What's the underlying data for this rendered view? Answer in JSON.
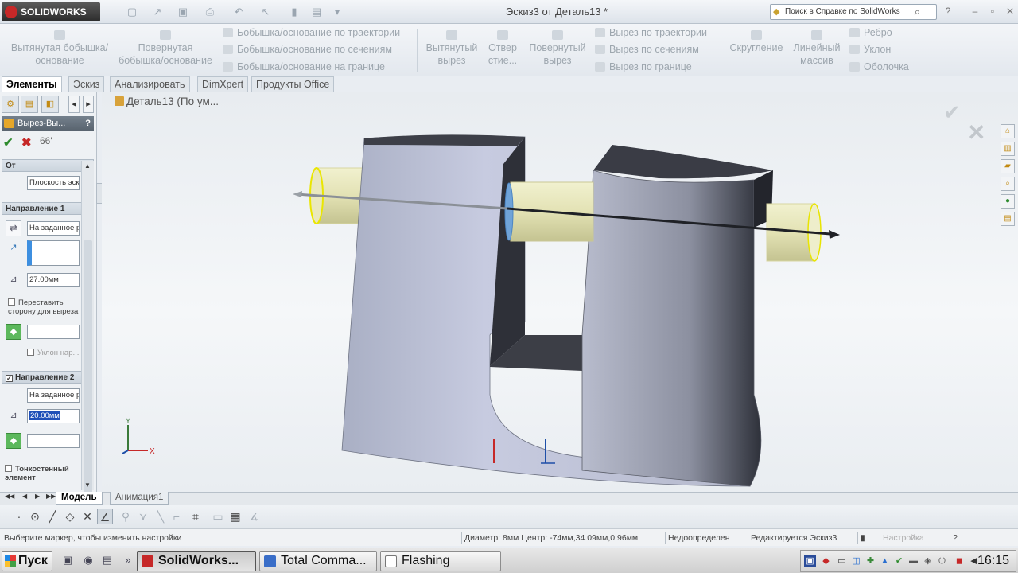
{
  "app": {
    "logo_text": "SOLIDWORKS",
    "document_title": "Эскиз3 от Деталь13 *",
    "help_search_placeholder": "Поиск в Справке по SolidWorks"
  },
  "ribbon": {
    "extrude_boss": "Вытянутая бобышка/основание",
    "revolve_boss": "Повернутая бобышка/основание",
    "sweep_boss": "Бобышка/основание по траектории",
    "loft_boss": "Бобышка/основание по сечениям",
    "boundary_boss": "Бобышка/основание на границе",
    "extrude_cut": "Вытянутый вырез",
    "hole_wizard": "Отвер стие...",
    "revolve_cut": "Повернутый вырез",
    "sweep_cut": "Вырез по траектории",
    "loft_cut": "Вырез по сечениям",
    "boundary_cut": "Вырез по границе",
    "fillet": "Скругление",
    "linear_pattern": "Линейный массив",
    "rib": "Ребро",
    "draft": "Уклон",
    "shell": "Оболочка"
  },
  "tabs": {
    "features": "Элементы",
    "sketch": "Эскиз",
    "evaluate": "Анализировать",
    "dimxpert": "DimXpert",
    "office": "Продукты Office"
  },
  "property_manager": {
    "title": "Вырез-Вы...",
    "from_label": "От",
    "from_value": "Плоскость эскиза",
    "dir1_label": "Направление 1",
    "dir1_end_condition": "На заданное расстояние",
    "dir1_depth": "27.00мм",
    "flip_side_label": "Переставить сторону для выреза",
    "draft_label": "Уклон нар...",
    "dir2_label": "Направление 2",
    "dir2_end_condition": "На заданное расстояние",
    "dir2_depth": "20.00мм",
    "thin_feature_label": "Тонкостенный элемент"
  },
  "graphics": {
    "tree_crumb": "Деталь13  (По ум..."
  },
  "bottom_tabs": {
    "model": "Модель",
    "animation": "Анимация1"
  },
  "status": {
    "hint": "Выберите маркер, чтобы изменить настройки",
    "info": "Диаметр: 8мм Центр: -74мм,34.09мм,0.96мм",
    "sketch_state": "Недоопределен",
    "editing": "Редактируется Эскиз3",
    "config": "Настройка"
  },
  "taskbar": {
    "start": "Пуск",
    "solidworks": "SolidWorks...",
    "total_commander": "Total Comma...",
    "flashing": "Flashing",
    "time": "16:15"
  }
}
